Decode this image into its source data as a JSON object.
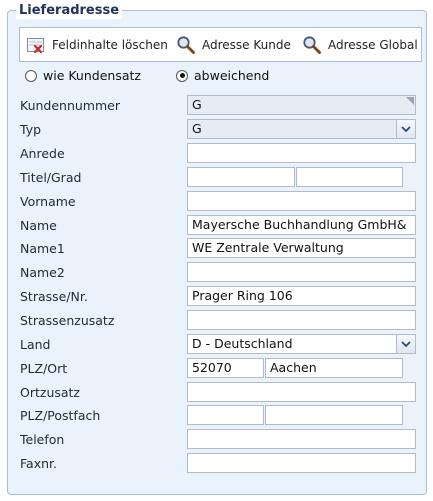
{
  "section": {
    "title": "Lieferadresse"
  },
  "toolbar": {
    "clear_label": "Feldinhalte löschen",
    "customer_address_label": "Adresse Kunde",
    "global_address_label": "Adresse Global"
  },
  "address_mode": {
    "options": [
      {
        "label": "wie Kundensatz",
        "checked": false
      },
      {
        "label": "abweichend",
        "checked": true
      }
    ]
  },
  "form": {
    "kundennummer": {
      "label": "Kundennummer",
      "value": "G"
    },
    "typ": {
      "label": "Typ",
      "value": "G"
    },
    "anrede": {
      "label": "Anrede",
      "value": ""
    },
    "titel": {
      "label": "Titel/Grad",
      "value1": "",
      "value2": ""
    },
    "vorname": {
      "label": "Vorname",
      "value": ""
    },
    "name": {
      "label": "Name",
      "value": "Mayersche  Buchhandlung GmbH&"
    },
    "name1": {
      "label": "Name1",
      "value": "WE Zentrale Verwaltung"
    },
    "name2": {
      "label": "Name2",
      "value": ""
    },
    "strasse": {
      "label": "Strasse/Nr.",
      "value": "Prager Ring 106"
    },
    "strassenzusatz": {
      "label": "Strassenzusatz",
      "value": ""
    },
    "land": {
      "label": "Land",
      "value": "D - Deutschland"
    },
    "plz_ort": {
      "label": "PLZ/Ort",
      "plz": "52070",
      "ort": "Aachen"
    },
    "ortszusatz": {
      "label": "Ortzusatz",
      "value": ""
    },
    "plz_postfach": {
      "label": "PLZ/Postfach",
      "plz": "",
      "postfach": ""
    },
    "telefon": {
      "label": "Telefon",
      "value": ""
    },
    "fax": {
      "label": "Faxnr.",
      "value": ""
    }
  }
}
